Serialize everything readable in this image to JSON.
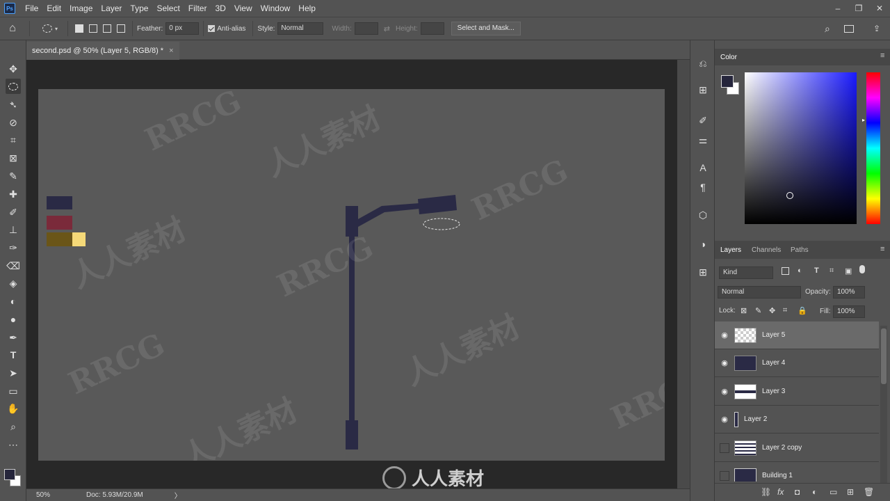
{
  "app": {
    "logo_text": "Ps"
  },
  "menu": [
    "File",
    "Edit",
    "Image",
    "Layer",
    "Type",
    "Select",
    "Filter",
    "3D",
    "View",
    "Window",
    "Help"
  ],
  "window_controls": [
    "–",
    "❐",
    "✕"
  ],
  "options": {
    "feather_label": "Feather:",
    "feather_value": "0 px",
    "antialias_label": "Anti-alias",
    "style_label": "Style:",
    "style_value": "Normal",
    "width_label": "Width:",
    "height_label": "Height:",
    "select_mask_label": "Select and Mask..."
  },
  "document": {
    "tab_title": "second.psd @ 50% (Layer 5, RGB/8) *",
    "close": "×"
  },
  "status": {
    "zoom": "50%",
    "doc": "Doc: 5.93M/20.9M",
    "arrow": "〉"
  },
  "color_panel": {
    "title": "Color",
    "fg_color": "#26263c",
    "bg_color": "#ffffff"
  },
  "layers_panel": {
    "tabs": [
      "Layers",
      "Channels",
      "Paths"
    ],
    "kind_label": "Kind",
    "blend_mode": "Normal",
    "opacity_label": "Opacity:",
    "opacity_value": "100%",
    "lock_label": "Lock:",
    "fill_label": "Fill:",
    "fill_value": "100%",
    "layers": [
      {
        "name": "Layer 5",
        "visible": true,
        "selected": true
      },
      {
        "name": "Layer 4",
        "visible": true,
        "selected": false
      },
      {
        "name": "Layer 3",
        "visible": true,
        "selected": false
      },
      {
        "name": "Layer 2",
        "visible": true,
        "selected": false
      },
      {
        "name": "Layer 2 copy",
        "visible": false,
        "selected": false
      },
      {
        "name": "Building 1",
        "visible": false,
        "selected": false
      }
    ]
  },
  "swatches": [
    "#2a2a45",
    "#7a2a3a",
    "#6a5518",
    "#f5d978"
  ],
  "watermarks": [
    "RRCG",
    "人人素材"
  ],
  "bottom_logo_text": "人人素材"
}
